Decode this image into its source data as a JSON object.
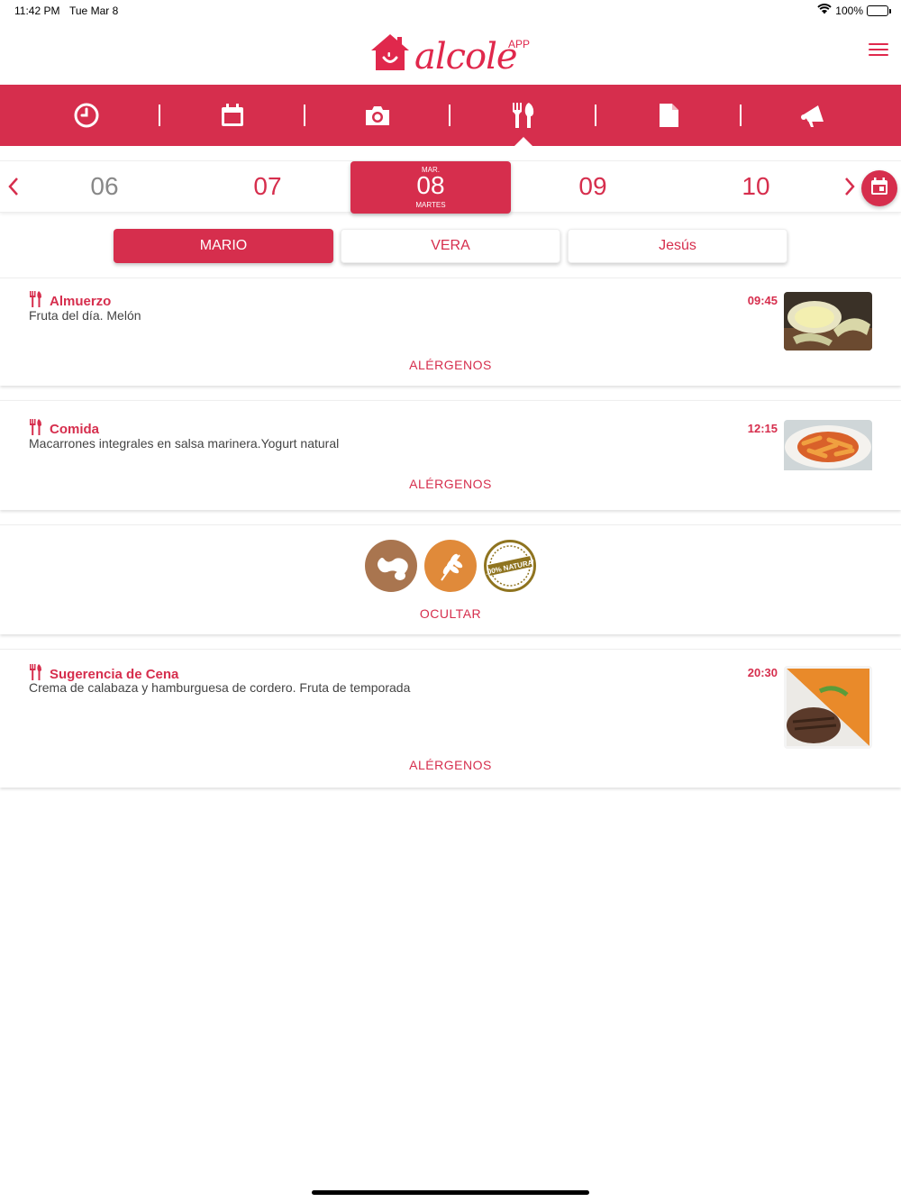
{
  "status_bar": {
    "time": "11:42 PM",
    "date": "Tue Mar 8",
    "battery": "100%"
  },
  "header": {
    "logo_text": "alcole",
    "logo_suffix": "APP"
  },
  "tabs": [
    {
      "icon": "clock-icon"
    },
    {
      "icon": "calendar-icon"
    },
    {
      "icon": "camera-icon"
    },
    {
      "icon": "fork-knife-icon",
      "active": true
    },
    {
      "icon": "document-icon"
    },
    {
      "icon": "megaphone-icon"
    }
  ],
  "dates": {
    "items": [
      "06",
      "07",
      "09",
      "10"
    ],
    "selected": {
      "month": "MAR.",
      "day": "08",
      "weekday": "MARTES"
    }
  },
  "children": [
    "MARIO",
    "VERA",
    "Jesús"
  ],
  "meals": [
    {
      "title": "Almuerzo",
      "description": "Fruta del día. Melón",
      "time": "09:45",
      "link": "ALÉRGENOS",
      "photo": "melon"
    },
    {
      "title": "Comida",
      "description": "Macarrones integrales en salsa marinera.Yogurt natural",
      "time": "12:15",
      "link": "ALÉRGENOS",
      "photo": "pasta"
    },
    {
      "title": "Sugerencia de Cena",
      "description": "Crema de calabaza y hamburguesa de cordero. Fruta de temporada",
      "time": "20:30",
      "link": "ALÉRGENOS",
      "photo": "soup-burger"
    }
  ],
  "allergens": {
    "icons": [
      "peanut-icon",
      "wheat-icon",
      "natural-product-seal-icon"
    ],
    "seal_text": "100% NATURAL",
    "hide_label": "OCULTAR"
  },
  "colors": {
    "brand": "#d62e4d",
    "allergen_brown": "#a9754f",
    "allergen_orange": "#e08a3a"
  }
}
